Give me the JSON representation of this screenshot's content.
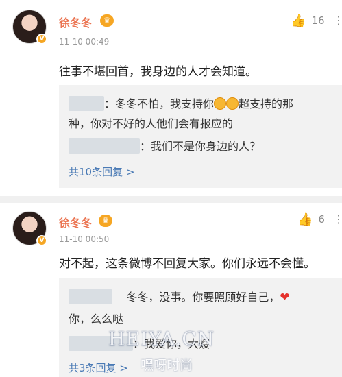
{
  "comments": [
    {
      "username": "徐冬冬",
      "vip_icon": "vip-crown-icon",
      "time": "11-10 00:49",
      "likes": "16",
      "text": "往事不堪回首，我身边的人才会知道。",
      "replies": [
        {
          "line1": "：冬冬不怕，我支持你",
          "line1b": "超支持的那",
          "line2": "种，你对不好的人他们会有报应的"
        },
        {
          "line1": "：我们不是你身边的人？"
        }
      ],
      "view_all": "共10条回复 >"
    },
    {
      "username": "徐冬冬",
      "vip_icon": "vip-crown-icon",
      "time": "11-10 00:50",
      "likes": "6",
      "text": "对不起，这条微博不回复大家。你们永远不会懂。",
      "replies": [
        {
          "line1": "冬冬，没事。你要照顾好自己，",
          "line2": "你，么么哒"
        },
        {
          "line1": "：我爱你，大嫂"
        }
      ],
      "view_all": "共3条回复 >"
    }
  ],
  "watermark": {
    "latin": "HEIYA.CN",
    "chinese": "嘿呀时尚"
  },
  "colors": {
    "username": "#eb7350",
    "link": "#4a7ab5",
    "reply_bg": "#f2f2f2"
  }
}
